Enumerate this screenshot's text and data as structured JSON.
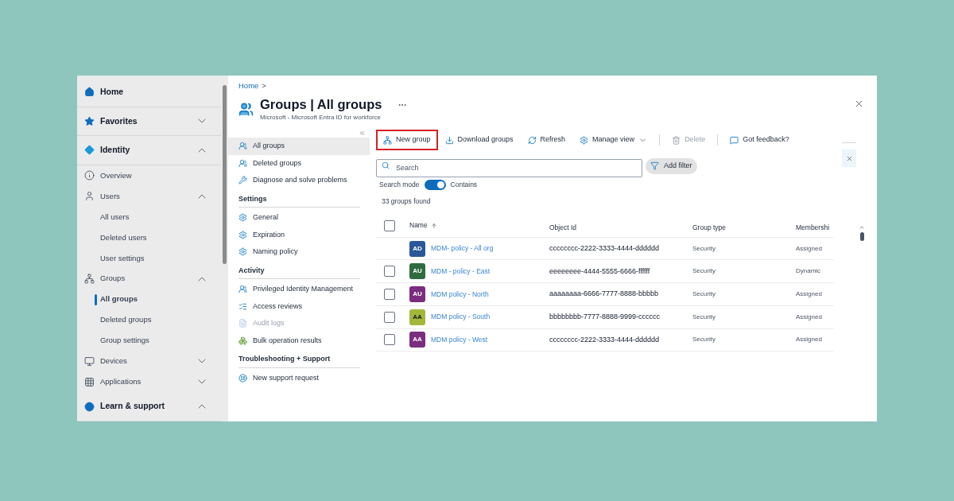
{
  "sidebar": {
    "items": [
      {
        "label": "Home"
      },
      {
        "label": "Favorites",
        "expanded": false
      },
      {
        "label": "Identity",
        "expanded": true,
        "children": [
          {
            "label": "Overview"
          },
          {
            "label": "Users",
            "expanded": true,
            "children": [
              {
                "label": "All users",
                "selected": false
              },
              {
                "label": "Deleted users",
                "selected": false
              },
              {
                "label": "User settings",
                "selected": false
              }
            ]
          },
          {
            "label": "Groups",
            "expanded": true,
            "children": [
              {
                "label": "All groups",
                "selected": true
              },
              {
                "label": "Deleted groups",
                "selected": false
              },
              {
                "label": "Group settings",
                "selected": false
              }
            ]
          },
          {
            "label": "Devices",
            "expanded": false
          },
          {
            "label": "Applications",
            "expanded": false
          }
        ]
      },
      {
        "label": "Learn & support",
        "expanded": true
      }
    ]
  },
  "breadcrumb": {
    "items": [
      "Home"
    ],
    "separator": ">"
  },
  "header": {
    "title": "Groups | All groups",
    "subtitle": "Microsoft - Microsoft Entra ID for workforce"
  },
  "blade_menu": {
    "sections": [
      {
        "items": [
          {
            "label": "All groups",
            "selected": true,
            "disabled": false
          },
          {
            "label": "Deleted groups",
            "selected": false,
            "disabled": false
          },
          {
            "label": "Diagnose and solve problems",
            "selected": false,
            "disabled": false
          }
        ]
      },
      {
        "heading": "Settings",
        "items": [
          {
            "label": "General",
            "selected": false,
            "disabled": false
          },
          {
            "label": "Expiration",
            "selected": false,
            "disabled": false
          },
          {
            "label": "Naming policy",
            "selected": false,
            "disabled": false
          }
        ]
      },
      {
        "heading": "Activity",
        "items": [
          {
            "label": "Privileged Identity Management",
            "selected": false,
            "disabled": false
          },
          {
            "label": "Access reviews",
            "selected": false,
            "disabled": false
          },
          {
            "label": "Audit logs",
            "selected": false,
            "disabled": true
          },
          {
            "label": "Bulk operation results",
            "selected": false,
            "disabled": false
          }
        ]
      },
      {
        "heading": "Troubleshooting + Support",
        "items": [
          {
            "label": "New support request",
            "selected": false,
            "disabled": false
          }
        ]
      }
    ]
  },
  "toolbar": [
    {
      "label": "New group",
      "highlighted": true,
      "disabled": false
    },
    {
      "label": "Download groups",
      "highlighted": false,
      "disabled": false
    },
    {
      "label": "Refresh",
      "highlighted": false,
      "disabled": false
    },
    {
      "label": "Manage view",
      "highlighted": false,
      "disabled": false
    },
    {
      "label": "Delete",
      "highlighted": false,
      "disabled": true
    },
    {
      "label": "Got feedback?",
      "highlighted": false,
      "disabled": false
    }
  ],
  "search": {
    "placeholder": "Search"
  },
  "add_filter": "Add filter",
  "search_mode": {
    "label": "Search mode",
    "on": true,
    "value": "Contains"
  },
  "result_count": "33 groups found",
  "table": {
    "columns": [
      "Name",
      "Object Id",
      "Group type",
      "Membershi"
    ],
    "select_all": {
      "checked": false
    },
    "rows": [
      {
        "initials": "AD",
        "color": "#2b579a",
        "name": "MDM- policy - All org",
        "object_id": "cccccccc-2222-3333-4444-dddddd",
        "group_type": "Security",
        "membership": "Assigned"
      },
      {
        "initials": "AU",
        "color": "#2e6b3f",
        "name": "MDM - policy - East",
        "object_id": "eeeeeeee-4444-5555-6666-ffffff",
        "group_type": "Security",
        "membership": "Dynamic",
        "checked": false
      },
      {
        "initials": "AU",
        "color": "#7b2d7f",
        "name": "MDM policy - North",
        "object_id": "aaaaaaaa-6666-7777-8888-bbbbb",
        "group_type": "Security",
        "membership": "Assigned",
        "checked": false
      },
      {
        "initials": "AA",
        "color": "#a3b83a",
        "name": "MDM policy - South",
        "object_id": "bbbbbbbb-7777-8888-9999-cccccc",
        "group_type": "Security",
        "membership": "Assigned",
        "checked": false
      },
      {
        "initials": "AA",
        "color": "#7b2d7f",
        "name": "MDM policy - West",
        "object_id": "cccccccc-2222-3333-4444-dddddd",
        "group_type": "Security",
        "membership": "Assigned",
        "checked": false
      }
    ]
  }
}
